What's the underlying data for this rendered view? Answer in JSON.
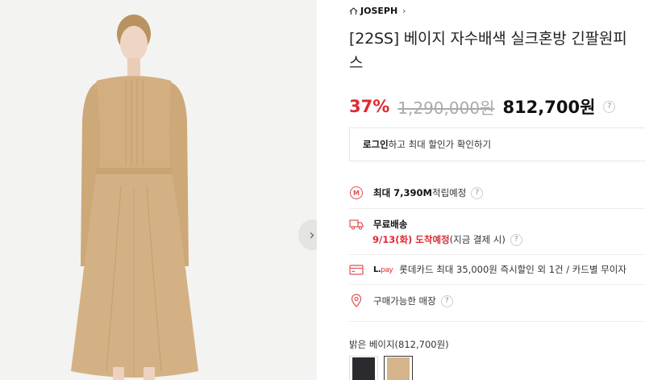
{
  "brand": {
    "name": "JOSEPH",
    "home_icon": "home-outline-icon",
    "chevron": "›"
  },
  "product": {
    "title": "[22SS] 베이지 자수배색 실크혼방 긴팔원피스"
  },
  "price": {
    "discount": "37%",
    "original": "1,290,000원",
    "sale": "812,700원",
    "help": "?"
  },
  "login_prompt": {
    "strong": "로그인",
    "rest": "하고 최대 할인가 확인하기"
  },
  "benefits": {
    "points": {
      "strong": "최대 7,390M",
      "rest": " 적립예정",
      "icon_text": "M",
      "help": "?"
    },
    "shipping": {
      "title": "무료배송",
      "date": "9/13(화) 도착예정",
      "note": " (지금 결제 시)",
      "help": "?"
    },
    "card": {
      "logo_l": "L.",
      "logo_pay": "pay",
      "text": "롯데카드 최대 35,000원 즉시할인 외 1건 / 카드별 무이자"
    },
    "store": {
      "label": "구매가능한 매장",
      "help": "?"
    }
  },
  "color": {
    "label": "밝은 베이지(812,700원)",
    "options": [
      {
        "name": "black",
        "hex": "#2a2b2e"
      },
      {
        "name": "light-beige",
        "hex": "#d4b48a"
      }
    ]
  },
  "gallery": {
    "next_arrow": "›"
  },
  "colors": {
    "accent_red": "#e0292f",
    "dress": "#d2ae80",
    "background": "#f3f3f1"
  }
}
